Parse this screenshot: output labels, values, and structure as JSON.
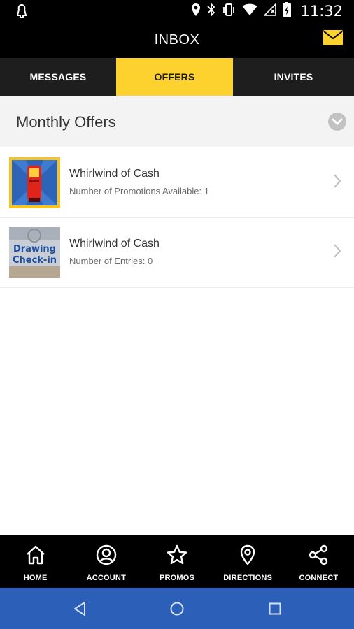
{
  "status_bar": {
    "time": "11:32",
    "icons": [
      "notification-icon",
      "location-icon",
      "bluetooth-icon",
      "vibrate-icon",
      "wifi-icon",
      "no-signal-icon",
      "battery-icon"
    ]
  },
  "header": {
    "title": "INBOX",
    "mail_icon": "mail-icon"
  },
  "tabs": [
    {
      "label": "MESSAGES",
      "selected": false
    },
    {
      "label": "OFFERS",
      "selected": true
    },
    {
      "label": "INVITES",
      "selected": false
    }
  ],
  "section": {
    "title": "Monthly Offers",
    "toggle_icon": "chevron-down-circle-icon"
  },
  "offers": [
    {
      "title": "Whirlwind of Cash",
      "subtitle": "Number of Promotions Available: 1",
      "thumbnail": "kiosk-image"
    },
    {
      "title": "Whirlwind of Cash",
      "subtitle": "Number of Entries: 0",
      "thumbnail": "drawing-checkin-image",
      "thumbnail_text": [
        "Drawing",
        "Check-in"
      ]
    }
  ],
  "bottom_nav": [
    {
      "label": "HOME",
      "icon": "home-icon"
    },
    {
      "label": "ACCOUNT",
      "icon": "account-icon"
    },
    {
      "label": "PROMOS",
      "icon": "star-icon"
    },
    {
      "label": "DIRECTIONS",
      "icon": "location-pin-icon"
    },
    {
      "label": "CONNECT",
      "icon": "share-icon"
    }
  ],
  "system_nav": [
    "back-icon",
    "home-circle-icon",
    "recents-icon"
  ],
  "colors": {
    "accent": "#fdd12e",
    "header_bg": "#000000",
    "tab_bg": "#1e1e1e",
    "system_nav_bg": "#2c60b8"
  }
}
